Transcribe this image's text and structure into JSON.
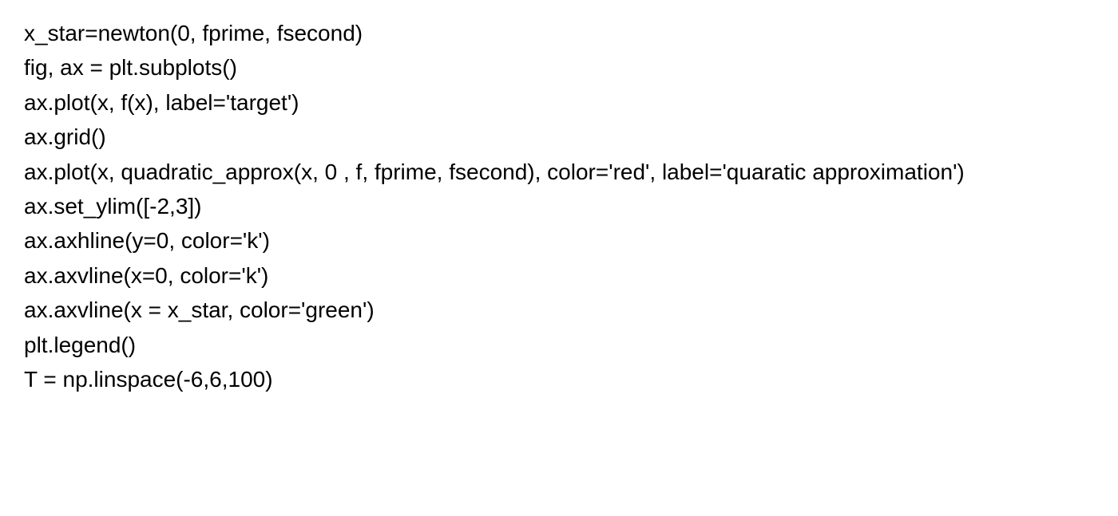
{
  "code": {
    "lines": [
      "x_star=newton(0, fprime, fsecond)",
      "fig, ax = plt.subplots()",
      "ax.plot(x, f(x), label='target')",
      "ax.grid()",
      "ax.plot(x, quadratic_approx(x, 0 , f, fprime, fsecond), color='red', label='quaratic approximation')",
      "ax.set_ylim([-2,3])",
      "ax.axhline(y=0, color='k')",
      "ax.axvline(x=0, color='k')",
      "ax.axvline(x = x_star, color='green')",
      "plt.legend()",
      "T = np.linspace(-6,6,100)"
    ]
  }
}
